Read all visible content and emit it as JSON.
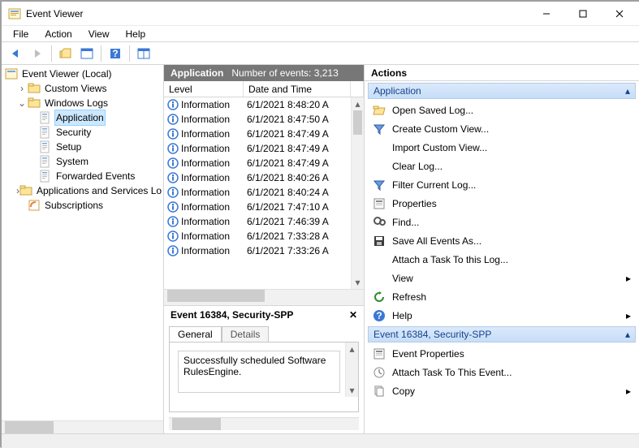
{
  "window": {
    "title": "Event Viewer"
  },
  "menu": [
    "File",
    "Action",
    "View",
    "Help"
  ],
  "tree": {
    "root": "Event Viewer (Local)",
    "custom_views": "Custom Views",
    "windows_logs": "Windows Logs",
    "wl_children": [
      "Application",
      "Security",
      "Setup",
      "System",
      "Forwarded Events"
    ],
    "apps_services": "Applications and Services Lo",
    "subscriptions": "Subscriptions"
  },
  "mid": {
    "header_title": "Application",
    "header_count": "Number of events: 3,213",
    "col_level": "Level",
    "col_date": "Date and Time",
    "rows": [
      {
        "level": "Information",
        "date": "6/1/2021 8:48:20 A"
      },
      {
        "level": "Information",
        "date": "6/1/2021 8:47:50 A"
      },
      {
        "level": "Information",
        "date": "6/1/2021 8:47:49 A"
      },
      {
        "level": "Information",
        "date": "6/1/2021 8:47:49 A"
      },
      {
        "level": "Information",
        "date": "6/1/2021 8:47:49 A"
      },
      {
        "level": "Information",
        "date": "6/1/2021 8:40:26 A"
      },
      {
        "level": "Information",
        "date": "6/1/2021 8:40:24 A"
      },
      {
        "level": "Information",
        "date": "6/1/2021 7:47:10 A"
      },
      {
        "level": "Information",
        "date": "6/1/2021 7:46:39 A"
      },
      {
        "level": "Information",
        "date": "6/1/2021 7:33:28 A"
      },
      {
        "level": "Information",
        "date": "6/1/2021 7:33:26 A"
      }
    ],
    "detail_title": "Event 16384, Security-SPP",
    "tab_general": "General",
    "tab_details": "Details",
    "message": "Successfully scheduled Software RulesEngine."
  },
  "actions": {
    "title": "Actions",
    "section1": "Application",
    "items1": [
      {
        "icon": "folder-open",
        "label": "Open Saved Log..."
      },
      {
        "icon": "filter",
        "label": "Create Custom View..."
      },
      {
        "icon": "blank",
        "label": "Import Custom View..."
      },
      {
        "icon": "blank",
        "label": "Clear Log..."
      },
      {
        "icon": "filter",
        "label": "Filter Current Log..."
      },
      {
        "icon": "properties",
        "label": "Properties"
      },
      {
        "icon": "find",
        "label": "Find..."
      },
      {
        "icon": "save",
        "label": "Save All Events As..."
      },
      {
        "icon": "blank",
        "label": "Attach a Task To this Log..."
      },
      {
        "icon": "blank",
        "label": "View",
        "sub": true
      },
      {
        "icon": "refresh",
        "label": "Refresh"
      },
      {
        "icon": "help",
        "label": "Help",
        "sub": true
      }
    ],
    "section2": "Event 16384, Security-SPP",
    "items2": [
      {
        "icon": "properties",
        "label": "Event Properties"
      },
      {
        "icon": "task",
        "label": "Attach Task To This Event..."
      },
      {
        "icon": "copy",
        "label": "Copy",
        "sub": true
      }
    ]
  }
}
